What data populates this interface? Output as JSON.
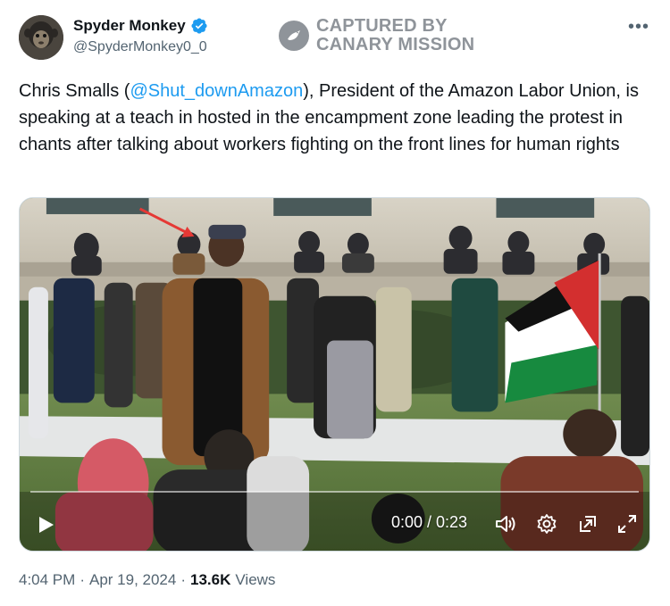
{
  "author": {
    "display_name": "Spyder Monkey",
    "handle": "@SpyderMonkey0_0",
    "avatar_icon": "monkey-avatar",
    "verified_icon": "verified-badge-icon"
  },
  "watermark": {
    "line1": "CAPTURED BY",
    "line2": "CANARY MISSION"
  },
  "more_icon": "more-options-icon",
  "tweet": {
    "text_before": "Chris Smalls (",
    "mention": "@Shut_downAmazon",
    "text_after": "), President of the Amazon Labor Union, is speaking at a teach in hosted in the encampment zone leading the protest in chants after talking about workers fighting on the front lines for human rights"
  },
  "video": {
    "timecode": "0:00 / 0:23",
    "progress": 0.0,
    "icons": [
      "play-icon",
      "volume-icon",
      "settings-icon",
      "pip-icon",
      "fullscreen-icon"
    ]
  },
  "meta": {
    "time": "4:04 PM",
    "sep1": "·",
    "date": "Apr 19, 2024",
    "sep2": "·",
    "views_count": "13.6K",
    "views_label": "Views"
  },
  "colors": {
    "accent": "#1d9bf0",
    "text": "#0f1419",
    "secondary": "#536471",
    "watermark": "#8f949a"
  }
}
